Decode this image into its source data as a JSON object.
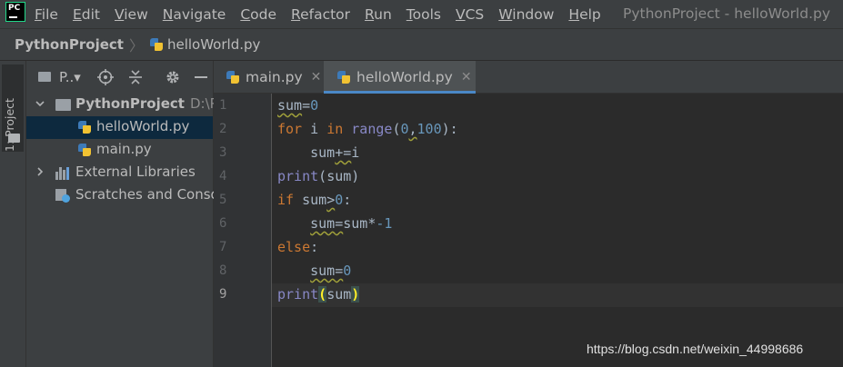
{
  "menubar": {
    "items": [
      {
        "underline": "F",
        "rest": "ile"
      },
      {
        "underline": "E",
        "rest": "dit"
      },
      {
        "underline": "V",
        "rest": "iew"
      },
      {
        "underline": "N",
        "rest": "avigate"
      },
      {
        "underline": "C",
        "rest": "ode"
      },
      {
        "underline": "R",
        "rest": "efactor"
      },
      {
        "underline": "R",
        "rest": "un"
      },
      {
        "underline": "T",
        "rest": "ools"
      },
      {
        "underline": "V",
        "rest": "CS"
      },
      {
        "underline": "W",
        "rest": "indow"
      },
      {
        "underline": "H",
        "rest": "elp"
      }
    ],
    "window_title": "PythonProject - helloWorld.py",
    "logo_text": "PC"
  },
  "breadcrumb": {
    "project": "PythonProject",
    "separator": "〉",
    "file": "helloWorld.py"
  },
  "stripe": {
    "project_tab_label": "1: Project"
  },
  "panel": {
    "title": "P..▾",
    "tree": {
      "project_name": "PythonProject",
      "project_path": "D:\\Py",
      "files": [
        "helloWorld.py",
        "main.py"
      ],
      "external_libraries": "External Libraries",
      "scratches": "Scratches and Conso"
    }
  },
  "tabs": [
    {
      "label": "main.py",
      "active": false
    },
    {
      "label": "helloWorld.py",
      "active": true
    }
  ],
  "editor": {
    "line_numbers": [
      "1",
      "2",
      "3",
      "4",
      "5",
      "6",
      "7",
      "8",
      "9"
    ],
    "current_line": 9,
    "code": [
      "sum=0",
      "for i in range(0,100):",
      "    sum+=i",
      "print(sum)",
      "if sum>0:",
      "    sum=sum*-1",
      "else:",
      "    sum=0",
      "print(sum)"
    ],
    "tokens": {
      "sum": "sum",
      "eq": "=",
      "zero": "0",
      "for": "for",
      "i": "i",
      "in": "in",
      "range": "range",
      "lparen": "(",
      "rparen": ")",
      "comma": ",",
      "hundred": "100",
      "colon": ":",
      "pluseq": "+=",
      "print": "print",
      "if": "if",
      "gt": ">",
      "star": "*",
      "minus_one": "-1",
      "else": "else"
    }
  },
  "watermark": "https://blog.csdn.net/weixin_44998686",
  "colors": {
    "background": "#2b2b2b",
    "panel": "#3c3f41",
    "keyword": "#cc7832",
    "builtin": "#8888c6",
    "number": "#6897bb",
    "identifier": "#a9b7c6",
    "selection": "#0d293e",
    "active_tab_underline": "#4a88c7"
  }
}
